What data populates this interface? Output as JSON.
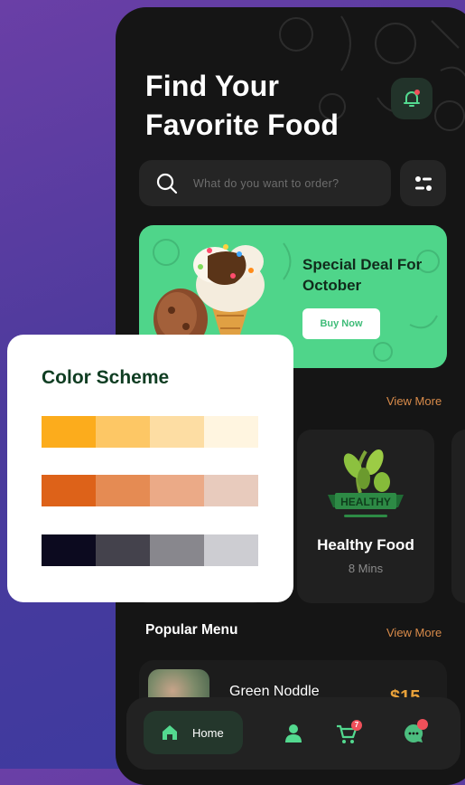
{
  "header": {
    "title_line1": "Find Your",
    "title_line2": "Favorite Food"
  },
  "search": {
    "placeholder": "What do you want to order?"
  },
  "promo": {
    "title": "Special Deal For October",
    "button": "Buy Now"
  },
  "section_nearest": {
    "view_more": "View More"
  },
  "restaurant_card": {
    "logo_text": "HEALTHY",
    "name": "Healthy Food",
    "time": "8 Mins"
  },
  "popular": {
    "title": "Popular Menu",
    "view_more": "View More",
    "items": [
      {
        "name": "Green Noddle",
        "price": "$15"
      }
    ]
  },
  "nav": {
    "home_label": "Home",
    "cart_badge": "7"
  },
  "color_scheme": {
    "title": "Color Scheme",
    "rows": [
      [
        "#fcac1c",
        "#fdc765",
        "#fddda3",
        "#fff5e0"
      ],
      [
        "#dd6219",
        "#e58b53",
        "#ebaa87",
        "#e8cbbd"
      ],
      [
        "#0c0a1f",
        "#44424c",
        "#88878d",
        "#cdcdd2"
      ]
    ]
  },
  "colors": {
    "accent_green": "#4fd58a",
    "accent_orange": "#d98b4a",
    "background": "#151515"
  }
}
